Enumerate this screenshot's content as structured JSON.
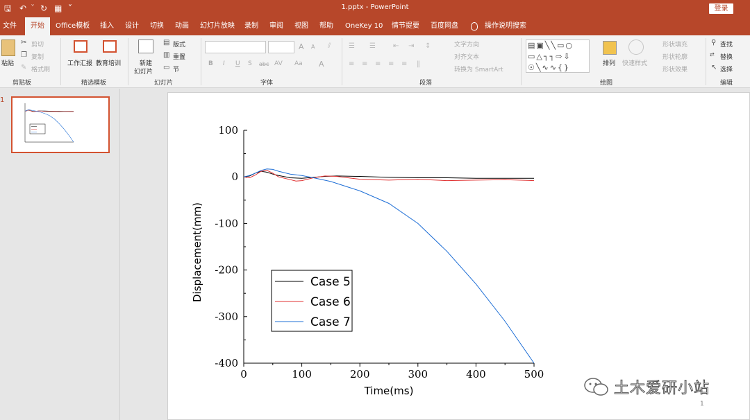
{
  "app": {
    "doc_title": "1.pptx  -  PowerPoint",
    "login_label": "登录"
  },
  "tabs": [
    {
      "label": "文件",
      "active": false
    },
    {
      "label": "开始",
      "active": true
    },
    {
      "label": "Office模板",
      "active": false
    },
    {
      "label": "插入",
      "active": false
    },
    {
      "label": "设计",
      "active": false
    },
    {
      "label": "切换",
      "active": false
    },
    {
      "label": "动画",
      "active": false
    },
    {
      "label": "幻灯片放映",
      "active": false
    },
    {
      "label": "录制",
      "active": false
    },
    {
      "label": "审阅",
      "active": false
    },
    {
      "label": "视图",
      "active": false
    },
    {
      "label": "帮助",
      "active": false
    },
    {
      "label": "OneKey 10",
      "active": false
    },
    {
      "label": "情节提要",
      "active": false
    },
    {
      "label": "百度网盘",
      "active": false
    }
  ],
  "tell_me": "操作说明搜索",
  "ribbon": {
    "clipboard": {
      "paste": "粘贴",
      "cut": "剪切",
      "copy": "复制",
      "format_painter": "格式刷",
      "group": "剪贴板"
    },
    "templates": {
      "work_report": "工作汇报",
      "edu_training": "教育培训",
      "group": "精选模板"
    },
    "slides": {
      "new_slide_1": "新建",
      "new_slide_2": "幻灯片",
      "layout": "版式",
      "reset": "重置",
      "section": "节",
      "group": "幻灯片"
    },
    "font": {
      "group": "字体",
      "bold": "B",
      "italic": "I",
      "underline": "U",
      "shadow": "S",
      "strike": "abc",
      "spacing": "AV",
      "case": "Aa",
      "color": "A",
      "grow": "A",
      "shrink": "A"
    },
    "paragraph": {
      "text_direction": "文字方向",
      "align_text": "对齐文本",
      "smartart": "转换为 SmartArt",
      "group": "段落"
    },
    "drawing": {
      "arrange": "排列",
      "quick_styles": "快速样式",
      "fill": "形状填充",
      "outline": "形状轮廓",
      "effects": "形状效果",
      "group": "绘图"
    },
    "editing": {
      "find": "查找",
      "replace": "替换",
      "select": "选择",
      "group": "编辑"
    }
  },
  "thumbnail": {
    "number": "1"
  },
  "slide": {
    "number": "1",
    "watermark": "土木爱研小站"
  },
  "colors": {
    "accent": "#b7472a",
    "case5": "#000000",
    "case6": "#e03030",
    "case7": "#1f6fd6"
  },
  "chart_data": {
    "type": "line",
    "xlabel": "Time(ms)",
    "ylabel": "Displacement(mm)",
    "xlim": [
      0,
      500
    ],
    "ylim": [
      -400,
      100
    ],
    "xticks": [
      0,
      100,
      200,
      300,
      400,
      500
    ],
    "yticks": [
      100,
      0,
      -100,
      -200,
      -300,
      -400
    ],
    "legend_position": "lower-left",
    "series": [
      {
        "name": "Case 5",
        "color": "#000000",
        "x": [
          0,
          10,
          20,
          30,
          40,
          50,
          60,
          80,
          100,
          120,
          140,
          160,
          200,
          250,
          300,
          350,
          400,
          450,
          500
        ],
        "y": [
          0,
          2,
          8,
          12,
          10,
          6,
          3,
          -2,
          -3,
          -1,
          1,
          2,
          1,
          -1,
          -2,
          -2,
          -3,
          -3,
          -3
        ]
      },
      {
        "name": "Case 6",
        "color": "#e03030",
        "x": [
          0,
          10,
          20,
          30,
          40,
          50,
          60,
          80,
          90,
          100,
          120,
          140,
          160,
          200,
          250,
          300,
          350,
          400,
          450,
          500
        ],
        "y": [
          0,
          -2,
          4,
          12,
          14,
          8,
          0,
          -6,
          -9,
          -8,
          -2,
          2,
          1,
          -5,
          -7,
          -5,
          -8,
          -7,
          -6,
          -8
        ]
      },
      {
        "name": "Case 7",
        "color": "#1f6fd6",
        "x": [
          0,
          10,
          20,
          30,
          40,
          50,
          60,
          80,
          100,
          120,
          150,
          200,
          250,
          300,
          350,
          400,
          450,
          500
        ],
        "y": [
          0,
          3,
          8,
          14,
          17,
          16,
          12,
          6,
          3,
          -2,
          -10,
          -30,
          -57,
          -100,
          -160,
          -230,
          -310,
          -400
        ]
      }
    ]
  }
}
